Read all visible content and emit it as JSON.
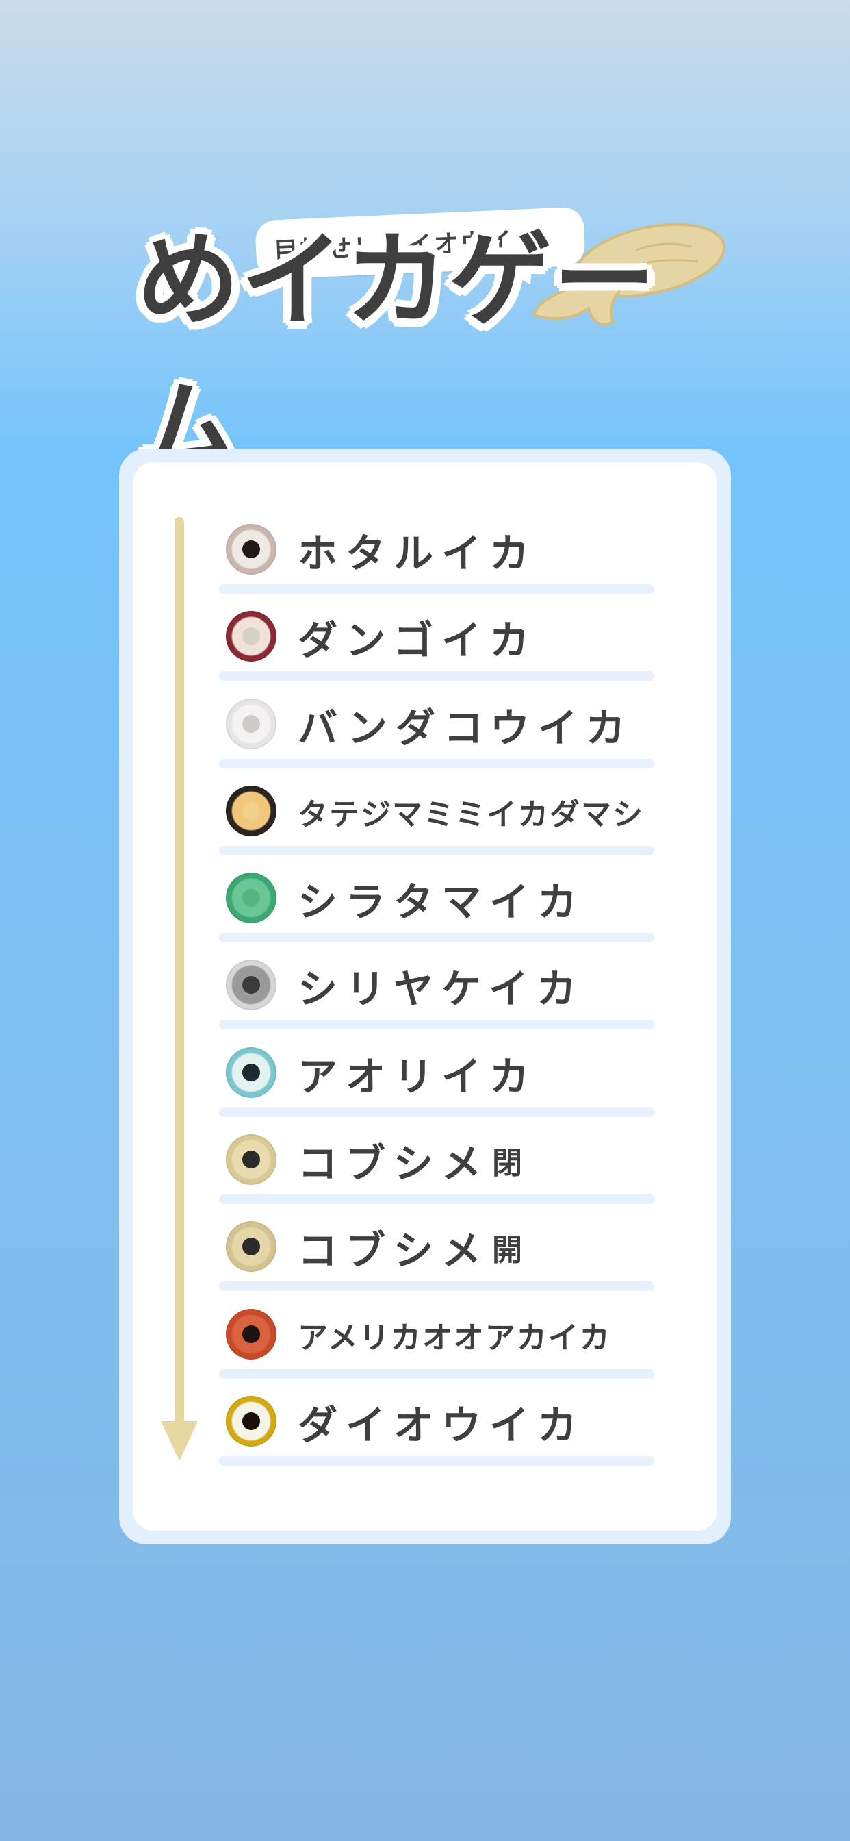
{
  "header": {
    "bubble": "目指せ！ダイオウイカ！",
    "logo": "めイカゲーム"
  },
  "species": [
    {
      "name": "ホタルイカ",
      "suffix": "",
      "eye_icon": "firefly-squid-eye-icon",
      "ring": "#c9b7ae",
      "inner": "#efe9e3",
      "pupil": "#1f1b1a",
      "size": "big"
    },
    {
      "name": "ダンゴイカ",
      "suffix": "",
      "eye_icon": "bobtail-squid-eye-icon",
      "ring": "#8b2a35",
      "inner": "#f0e1d9",
      "pupil": "#d9d0c4",
      "size": "big"
    },
    {
      "name": "バンダコウイカ",
      "suffix": "",
      "eye_icon": "bandako-cuttlefish-eye-icon",
      "ring": "#e6e4e4",
      "inner": "#f5f3f2",
      "pupil": "#cfcaca",
      "size": "big"
    },
    {
      "name": "タテジマミミイカダマシ",
      "suffix": "",
      "eye_icon": "striped-bobtail-eye-icon",
      "ring": "#2a2520",
      "inner": "#f0c77c",
      "pupil": "#f2d089",
      "size": "small"
    },
    {
      "name": "シラタマイカ",
      "suffix": "",
      "eye_icon": "shiratama-squid-eye-icon",
      "ring": "#3ea874",
      "inner": "#69c796",
      "pupil": "#52b582",
      "size": "big"
    },
    {
      "name": "シリヤケイカ",
      "suffix": "",
      "eye_icon": "shiriyake-cuttlefish-eye-icon",
      "ring": "#d7d7d7",
      "inner": "#9a9a9a",
      "pupil": "#3b3b3b",
      "size": "big"
    },
    {
      "name": "アオリイカ",
      "suffix": "",
      "eye_icon": "bigfin-reef-squid-eye-icon",
      "ring": "#7cc6cf",
      "inner": "#e2f2ee",
      "pupil": "#1e2a33",
      "size": "big"
    },
    {
      "name": "コブシメ",
      "suffix": "閉",
      "eye_icon": "broadclub-cuttlefish-closed-eye-icon",
      "ring": "#d8c995",
      "inner": "#e8dcaf",
      "pupil": "#2b2b2b",
      "size": "big"
    },
    {
      "name": "コブシメ",
      "suffix": "開",
      "eye_icon": "broadclub-cuttlefish-open-eye-icon",
      "ring": "#d3c391",
      "inner": "#e4d6a6",
      "pupil": "#2b2b2b",
      "size": "big"
    },
    {
      "name": "アメリカオオアカイカ",
      "suffix": "",
      "eye_icon": "humboldt-squid-eye-icon",
      "ring": "#c84a2a",
      "inner": "#d8633e",
      "pupil": "#1c1411",
      "size": "small"
    },
    {
      "name": "ダイオウイカ",
      "suffix": "",
      "eye_icon": "giant-squid-eye-icon",
      "ring": "#d2aa12",
      "inner": "#f6f3e7",
      "pupil": "#1a0f0a",
      "size": "big"
    }
  ],
  "colors": {
    "arrow": "#e8d6a1",
    "text": "#3f3f3f",
    "underline": "#e6f1fd"
  }
}
